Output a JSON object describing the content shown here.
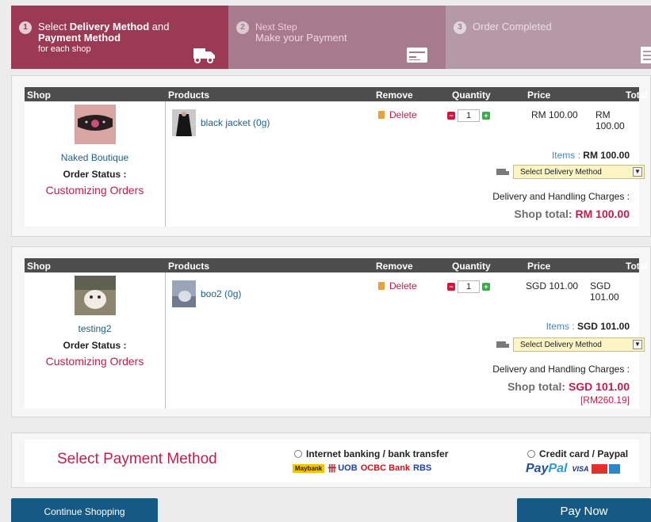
{
  "steps": [
    {
      "number": "1",
      "prefix": "Select ",
      "bold": "Delivery Method",
      "mid": " and",
      "bold2": "Payment Method",
      "sub": "for each shop"
    },
    {
      "number": "2",
      "title": "Next Step",
      "line2": "Make your Payment"
    },
    {
      "number": "3",
      "title": "Order Completed"
    }
  ],
  "table_headers": {
    "shop": "Shop",
    "products": "Products",
    "remove": "Remove",
    "quantity": "Quantity",
    "price": "Price",
    "total": "Total"
  },
  "shops": [
    {
      "name": "Naked Boutique",
      "order_status_label": "Order Status :",
      "order_status": "Customizing Orders",
      "product": "black jacket (0g)",
      "delete_label": "Delete",
      "quantity": "1",
      "price": "RM 100.00",
      "total": "RM 100.00",
      "items_label": "Items :",
      "items_value": "RM 100.00",
      "delivery_select": "Select Delivery Method",
      "delivery_charges": "Delivery and Handling Charges :",
      "shop_total_label": "Shop total:",
      "shop_total": "RM 100.00"
    },
    {
      "name": "testing2",
      "order_status_label": "Order Status :",
      "order_status": "Customizing Orders",
      "product": "boo2 (0g)",
      "delete_label": "Delete",
      "quantity": "1",
      "price": "SGD 101.00",
      "total": "SGD 101.00",
      "items_label": "Items :",
      "items_value": "SGD 101.00",
      "delivery_select": "Select Delivery Method",
      "delivery_charges": "Delivery and Handling Charges :",
      "shop_total_label": "Shop total:",
      "shop_total": "SGD 101.00",
      "converted": "[RM260.19]"
    }
  ],
  "payment": {
    "title": "Select Payment Method",
    "option1": "Internet banking / bank transfer",
    "option2": "Credit card / Paypal",
    "banks": {
      "maybank": "Maybank",
      "uob": "UOB",
      "ocbc": "OCBC Bank",
      "rbs": "RBS"
    },
    "cards": {
      "paypal_a": "Pay",
      "paypal_b": "Pal",
      "visa": "VISA"
    }
  },
  "buttons": {
    "continue": "Continue Shopping",
    "pay": "Pay Now"
  },
  "colors": {
    "accent": "#c31e4a",
    "step1_bg": "#9b3a55",
    "button_bg": "#155a84",
    "link": "#1f5f8b"
  },
  "icons": {
    "step1": "truck-icon",
    "step2": "bank-card-icon",
    "step3": "receipt-icon",
    "delete": "trash-icon",
    "delivery": "truck-icon"
  }
}
